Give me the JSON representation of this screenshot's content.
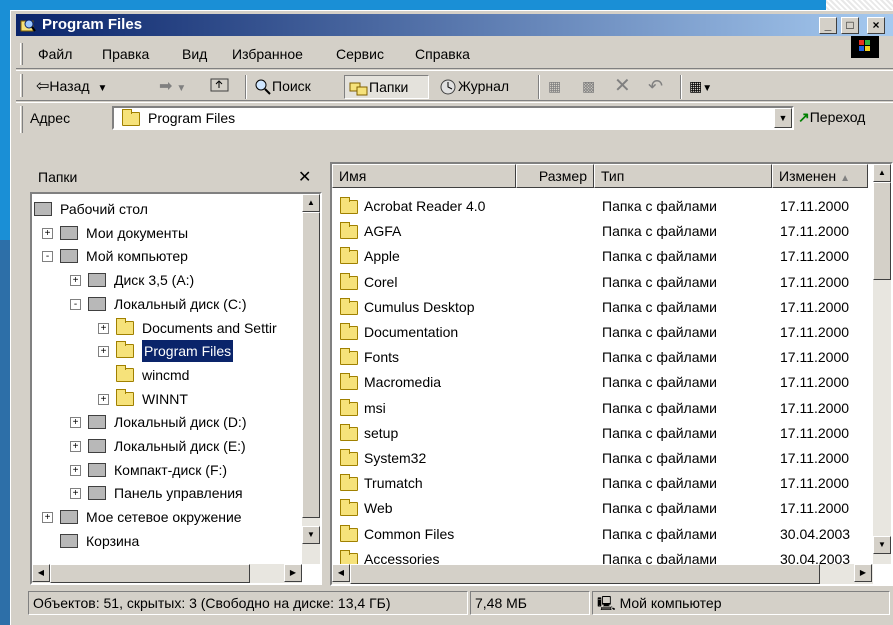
{
  "window": {
    "title": "Program Files"
  },
  "menu": [
    "Файл",
    "Правка",
    "Вид",
    "Избранное",
    "Сервис",
    "Справка"
  ],
  "toolbar": {
    "back": "Назад",
    "search": "Поиск",
    "folders": "Папки",
    "history": "Журнал"
  },
  "address": {
    "label": "Адрес",
    "value": "Program Files",
    "go": "Переход"
  },
  "folders_pane": {
    "title": "Папки",
    "tree": [
      {
        "label": "Рабочий стол",
        "icon": "desktop-icon",
        "level": 0,
        "toggle": ""
      },
      {
        "label": "Мои документы",
        "icon": "my-documents-icon",
        "level": 1,
        "toggle": "+"
      },
      {
        "label": "Мой компьютер",
        "icon": "my-computer-icon",
        "level": 1,
        "toggle": "-"
      },
      {
        "label": "Диск 3,5 (A:)",
        "icon": "floppy-drive-icon",
        "level": 2,
        "toggle": "+"
      },
      {
        "label": "Локальный диск (C:)",
        "icon": "hard-drive-icon",
        "level": 2,
        "toggle": "-"
      },
      {
        "label": "Documents and Settir",
        "icon": "folder-icon",
        "level": 3,
        "toggle": "+"
      },
      {
        "label": "Program Files",
        "icon": "folder-open-icon",
        "level": 3,
        "toggle": "+",
        "selected": true
      },
      {
        "label": "wincmd",
        "icon": "folder-icon",
        "level": 3,
        "toggle": ""
      },
      {
        "label": "WINNT",
        "icon": "folder-icon",
        "level": 3,
        "toggle": "+"
      },
      {
        "label": "Локальный диск (D:)",
        "icon": "hard-drive-icon",
        "level": 2,
        "toggle": "+"
      },
      {
        "label": "Локальный диск (E:)",
        "icon": "hard-drive-icon",
        "level": 2,
        "toggle": "+"
      },
      {
        "label": "Компакт-диск (F:)",
        "icon": "cd-drive-icon",
        "level": 2,
        "toggle": "+"
      },
      {
        "label": "Панель управления",
        "icon": "control-panel-icon",
        "level": 2,
        "toggle": "+"
      },
      {
        "label": "Мое сетевое окружение",
        "icon": "network-icon",
        "level": 1,
        "toggle": "+"
      },
      {
        "label": "Корзина",
        "icon": "recycle-bin-icon",
        "level": 1,
        "toggle": ""
      }
    ]
  },
  "file_list": {
    "columns": [
      "Имя",
      "Размер",
      "Тип",
      "Изменен"
    ],
    "rows": [
      {
        "name": "Acrobat Reader 4.0",
        "size": "",
        "type": "Папка с файлами",
        "modified": "17.11.2000"
      },
      {
        "name": "AGFA",
        "size": "",
        "type": "Папка с файлами",
        "modified": "17.11.2000"
      },
      {
        "name": "Apple",
        "size": "",
        "type": "Папка с файлами",
        "modified": "17.11.2000"
      },
      {
        "name": "Corel",
        "size": "",
        "type": "Папка с файлами",
        "modified": "17.11.2000"
      },
      {
        "name": "Cumulus Desktop",
        "size": "",
        "type": "Папка с файлами",
        "modified": "17.11.2000"
      },
      {
        "name": "Documentation",
        "size": "",
        "type": "Папка с файлами",
        "modified": "17.11.2000"
      },
      {
        "name": "Fonts",
        "size": "",
        "type": "Папка с файлами",
        "modified": "17.11.2000"
      },
      {
        "name": "Macromedia",
        "size": "",
        "type": "Папка с файлами",
        "modified": "17.11.2000"
      },
      {
        "name": "msi",
        "size": "",
        "type": "Папка с файлами",
        "modified": "17.11.2000"
      },
      {
        "name": "setup",
        "size": "",
        "type": "Папка с файлами",
        "modified": "17.11.2000"
      },
      {
        "name": "System32",
        "size": "",
        "type": "Папка с файлами",
        "modified": "17.11.2000"
      },
      {
        "name": "Trumatch",
        "size": "",
        "type": "Папка с файлами",
        "modified": "17.11.2000"
      },
      {
        "name": "Web",
        "size": "",
        "type": "Папка с файлами",
        "modified": "17.11.2000"
      },
      {
        "name": "Common Files",
        "size": "",
        "type": "Папка с файлами",
        "modified": "30.04.2003"
      },
      {
        "name": "Accessories",
        "size": "",
        "type": "Папка с файлами",
        "modified": "30.04.2003"
      }
    ]
  },
  "status": {
    "objects": "Объектов: 51, скрытых: 3 (Свободно на диске: 13,4 ГБ)",
    "size": "7,48 МБ",
    "location": "Мой компьютер"
  },
  "colors": {
    "title_start": "#0a246a",
    "title_end": "#a6caf0",
    "selection": "#0a246a",
    "chrome": "#d4d0c8"
  }
}
